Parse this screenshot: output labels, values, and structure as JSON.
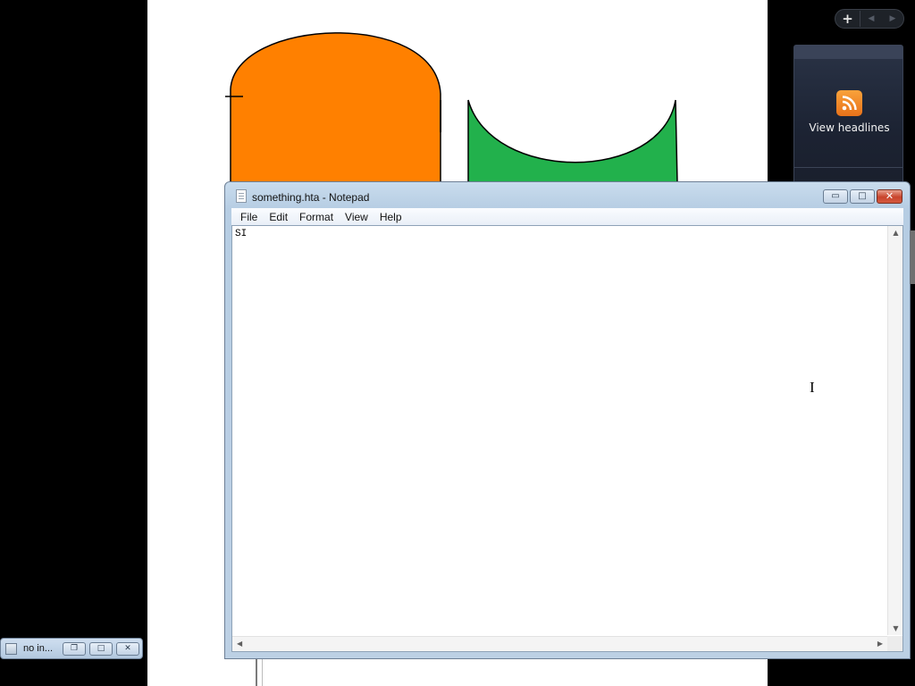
{
  "notepad": {
    "title": "something.hta - Notepad",
    "menu": [
      "File",
      "Edit",
      "Format",
      "View",
      "Help"
    ],
    "content": "SI",
    "buttons": {
      "minimize": "▭",
      "maximize": "□",
      "close": "✕"
    }
  },
  "gadget": {
    "label": "View headlines",
    "icon": "rss-feed-icon",
    "controls": {
      "add": "+",
      "prev": "◀",
      "next": "▶"
    }
  },
  "minimized_window": {
    "label": "no in..."
  },
  "colors": {
    "orange_shape": "#ff8000",
    "green_shape": "#22b14c",
    "rss_orange": "#f39130",
    "gadget_bg": "#1c2333"
  }
}
